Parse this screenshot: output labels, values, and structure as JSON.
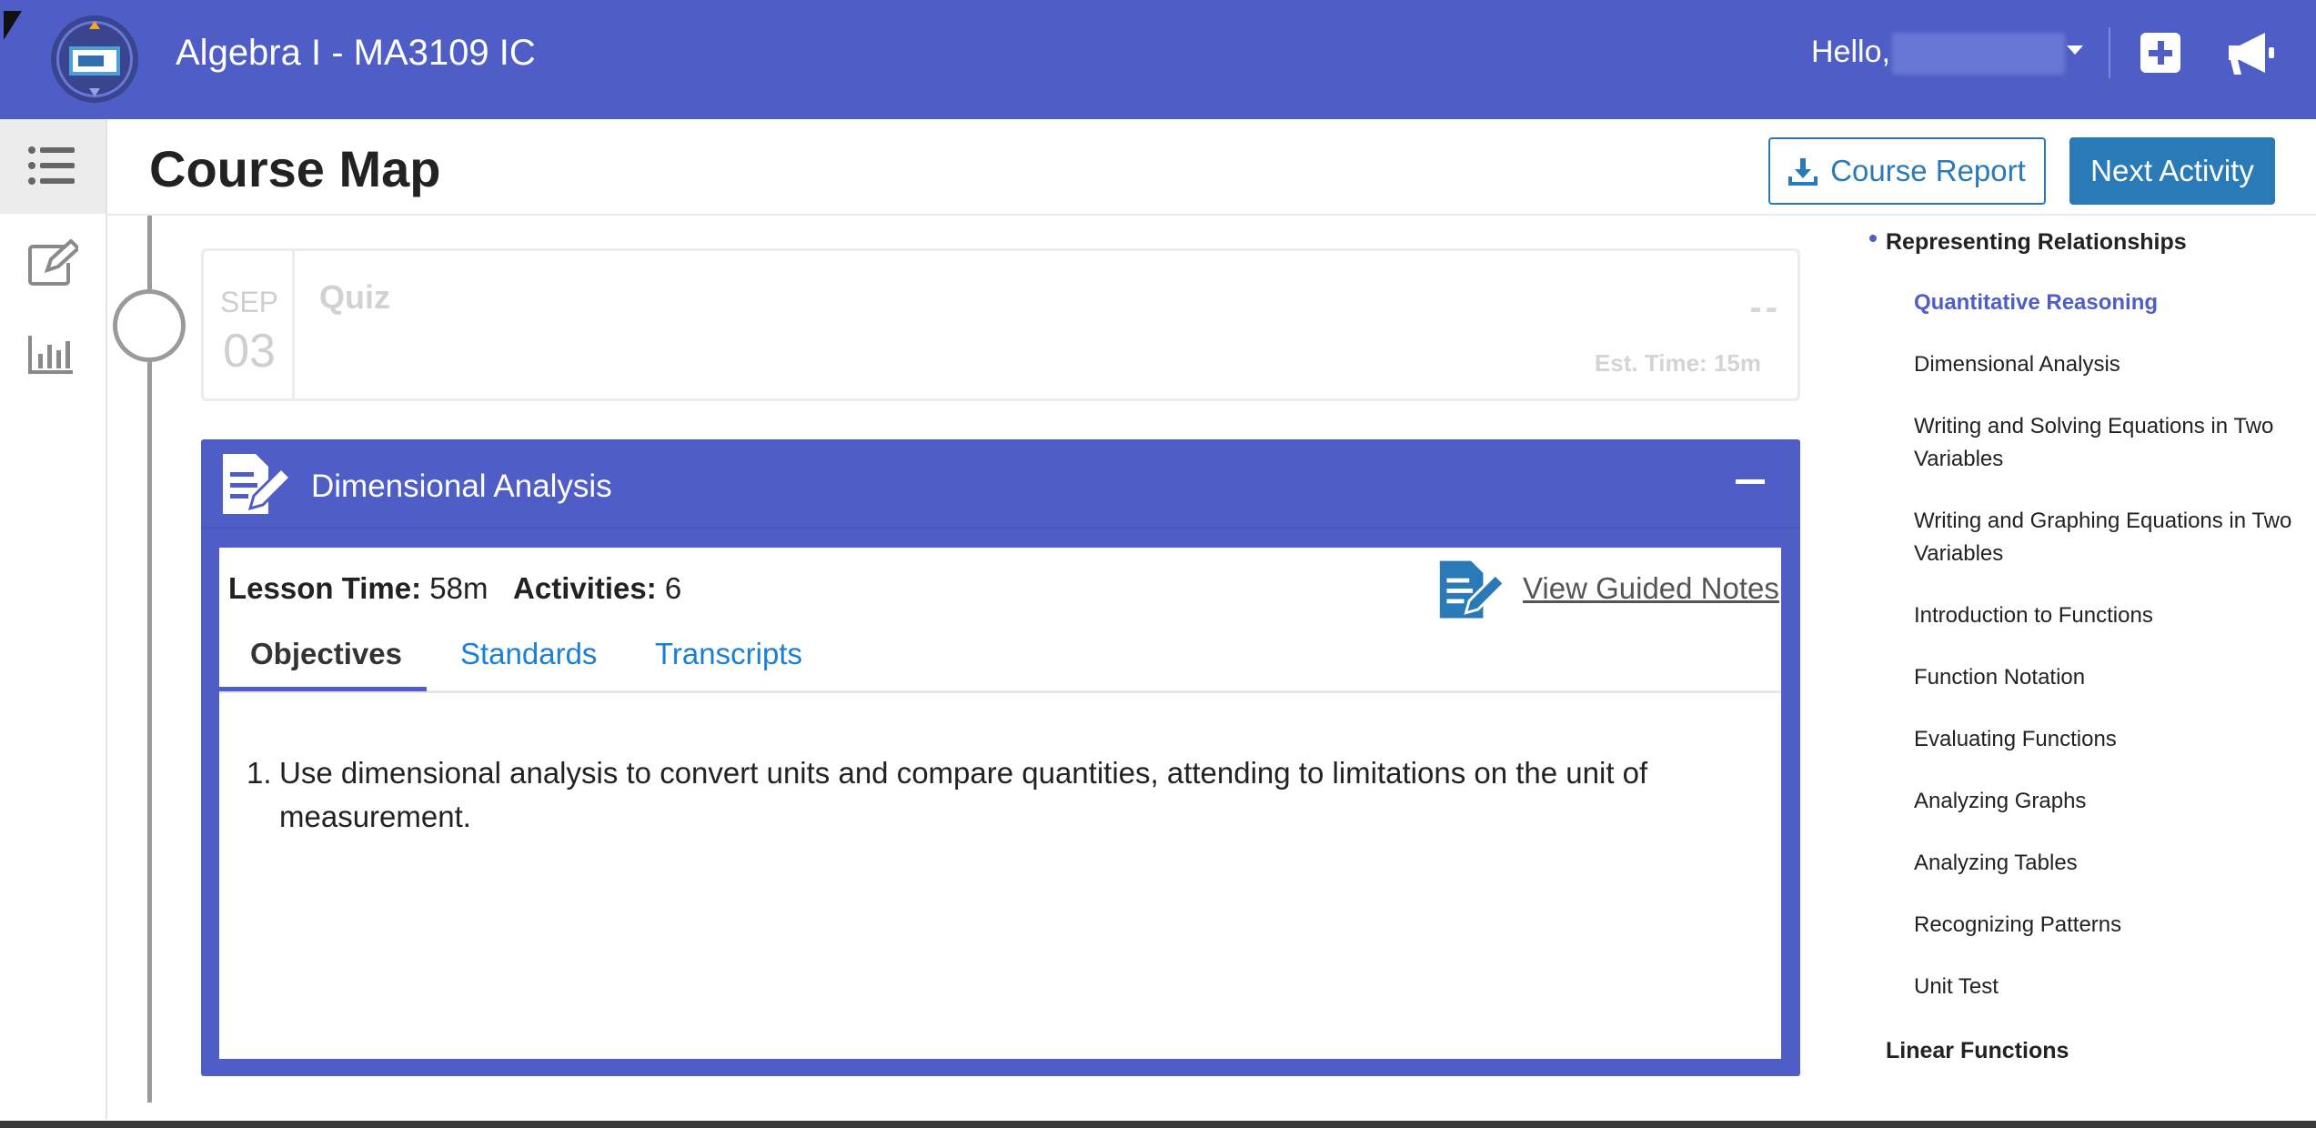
{
  "header": {
    "course_title": "Algebra I - MA3109 IC",
    "greeting": "Hello,",
    "logo_icon": "course-logo-icon",
    "add_icon": "plus-square-icon",
    "announcement_icon": "megaphone-icon",
    "brand_color": "#4f5ec7"
  },
  "rail": {
    "items": [
      {
        "icon": "list-icon",
        "active": true
      },
      {
        "icon": "edit-icon",
        "active": false
      },
      {
        "icon": "bar-chart-icon",
        "active": false
      }
    ]
  },
  "page": {
    "title": "Course Map",
    "report_button": "Course Report",
    "next_button": "Next Activity",
    "accent_color": "#2a7ab8"
  },
  "quiz": {
    "month": "SEP",
    "day": "03",
    "title": "Quiz",
    "score": "--",
    "est_time": "Est. Time: 15m"
  },
  "lesson": {
    "title": "Dimensional Analysis",
    "lesson_time_label": "Lesson Time:",
    "lesson_time_value": "58m",
    "activities_label": "Activities:",
    "activities_value": "6",
    "guided_notes": "View Guided Notes",
    "tabs": [
      "Objectives",
      "Standards",
      "Transcripts"
    ],
    "active_tab": "Objectives",
    "objectives": [
      {
        "number": "1.",
        "text": "Use dimensional analysis to convert units and compare quantities, attending to limitations on the unit of measurement."
      }
    ]
  },
  "outline": {
    "unit": "Representing Relationships",
    "items": [
      "Quantitative Reasoning",
      "Dimensional Analysis",
      "Writing and Solving Equations in Two Variables",
      "Writing and Graphing Equations in Two Variables",
      "Introduction to Functions",
      "Function Notation",
      "Evaluating Functions",
      "Analyzing Graphs",
      "Analyzing Tables",
      "Recognizing Patterns",
      "Unit Test"
    ],
    "current_item": "Quantitative Reasoning",
    "next_unit": "Linear Functions"
  }
}
